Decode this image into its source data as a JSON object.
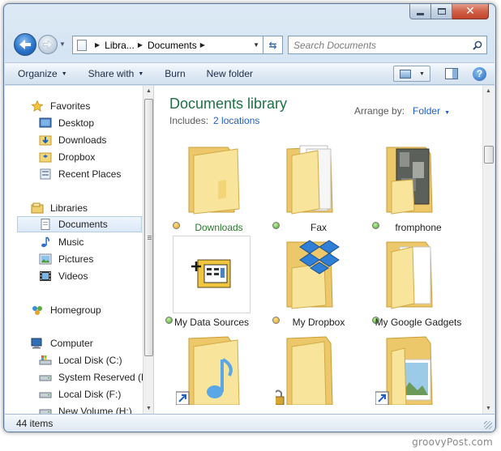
{
  "address": {
    "crumbs": [
      "Libra...",
      "Documents"
    ]
  },
  "search": {
    "placeholder": "Search Documents"
  },
  "toolbar": {
    "organize": "Organize",
    "share_with": "Share with",
    "burn": "Burn",
    "new_folder": "New folder"
  },
  "nav": {
    "favorites": "Favorites",
    "desktop": "Desktop",
    "downloads": "Downloads",
    "dropbox": "Dropbox",
    "recent": "Recent Places",
    "libraries": "Libraries",
    "documents": "Documents",
    "music": "Music",
    "pictures": "Pictures",
    "videos": "Videos",
    "homegroup": "Homegroup",
    "computer": "Computer",
    "disk_c": "Local Disk (C:)",
    "system_reserved": "System Reserved (E:",
    "disk_f": "Local Disk (F:)",
    "new_volume": "New Volume (H:)"
  },
  "library": {
    "title": "Documents library",
    "includes_label": "Includes:",
    "locations_link": "2 locations",
    "arrange_label": "Arrange by:",
    "arrange_value": "Folder"
  },
  "items": [
    {
      "label": "Downloads"
    },
    {
      "label": "Fax"
    },
    {
      "label": "fromphone"
    },
    {
      "label": "My Data Sources"
    },
    {
      "label": "My Dropbox"
    },
    {
      "label": "My Google Gadgets"
    }
  ],
  "status": {
    "count": "44 items"
  },
  "watermark": "groovyPost.com"
}
